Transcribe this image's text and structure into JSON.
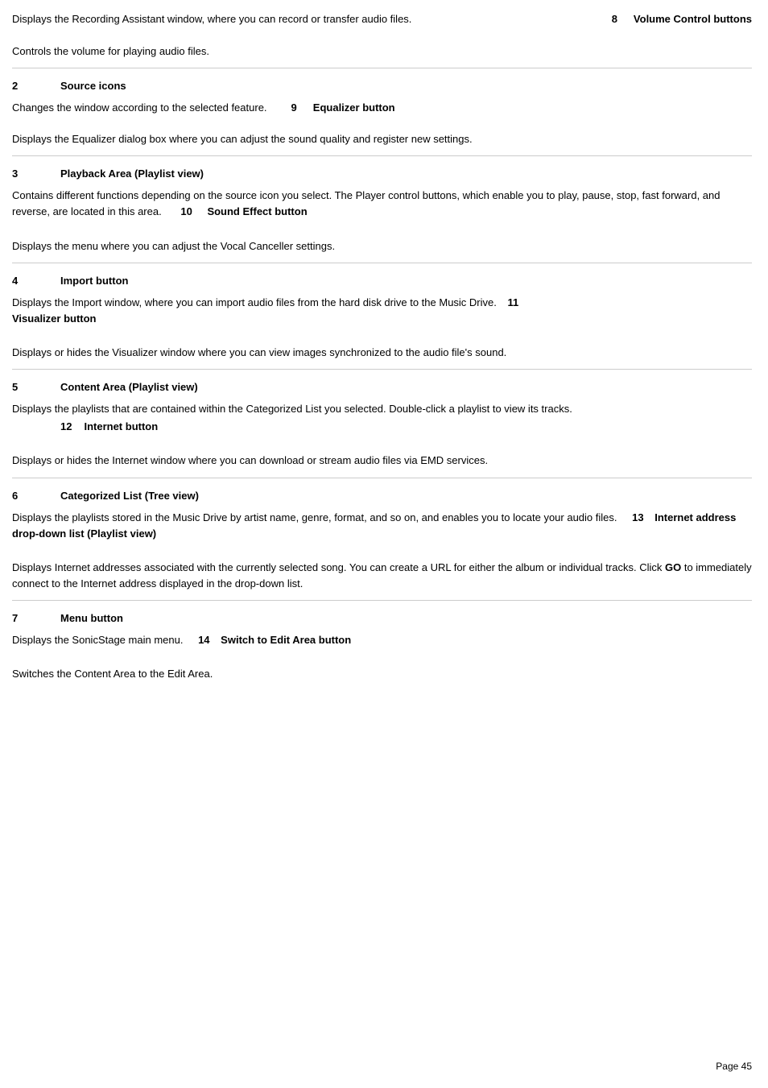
{
  "page": {
    "page_number": "Page 45",
    "intro_text": "Displays the Recording Assistant window, where you can record or transfer audio files.",
    "sections": [
      {
        "id": "s8",
        "number": "8",
        "title": "Volume Control buttons",
        "description": "Controls the volume for playing audio files."
      },
      {
        "id": "s2",
        "number": "2",
        "title": "Source icons",
        "description": "Changes the window according to the selected feature."
      },
      {
        "id": "s9",
        "number": "9",
        "title": "Equalizer button",
        "description": "Displays the Equalizer dialog box where you can adjust the sound quality and register new settings."
      },
      {
        "id": "s3",
        "number": "3",
        "title": "Playback Area (Playlist view)",
        "description": "Contains different functions depending on the source icon you select. The Player control buttons, which enable you to play, pause, stop, fast forward, and reverse, are located in this area."
      },
      {
        "id": "s10",
        "number": "10",
        "title": "Sound Effect button",
        "description": "Displays the menu where you can adjust the Vocal Canceller settings."
      },
      {
        "id": "s4",
        "number": "4",
        "title": "Import button",
        "description": "Displays the Import window, where you can import audio files from the hard disk drive to the Music Drive."
      },
      {
        "id": "s11",
        "number": "11",
        "title": "Visualizer button",
        "description": "Displays or hides the Visualizer window where you can view images synchronized to the audio file's sound."
      },
      {
        "id": "s5",
        "number": "5",
        "title": "Content Area (Playlist view)",
        "description": "Displays the playlists that are contained within the Categorized List you selected. Double-click a playlist to view its tracks."
      },
      {
        "id": "s12",
        "number": "12",
        "title": "Internet button",
        "description": "Displays or hides the Internet window where you can download or stream audio files via EMD services."
      },
      {
        "id": "s6",
        "number": "6",
        "title": "Categorized List (Tree view)",
        "description": "Displays the playlists stored in the Music Drive by artist name, genre, format, and so on, and enables you to locate your audio files."
      },
      {
        "id": "s13",
        "number": "13",
        "title": "Internet address drop-down list (Playlist view)",
        "description_part1": "Displays Internet addresses associated with the currently selected song. You can create a URL for either the album or individual tracks. Click ",
        "description_bold": "GO",
        "description_part2": " to immediately connect to the Internet address displayed in the drop-down list."
      },
      {
        "id": "s7",
        "number": "7",
        "title": "Menu button",
        "description_before": "Displays the SonicStage main menu."
      },
      {
        "id": "s14",
        "number": "14",
        "title": "Switch to Edit Area button",
        "description": "Switches the Content Area to the Edit Area."
      }
    ]
  }
}
